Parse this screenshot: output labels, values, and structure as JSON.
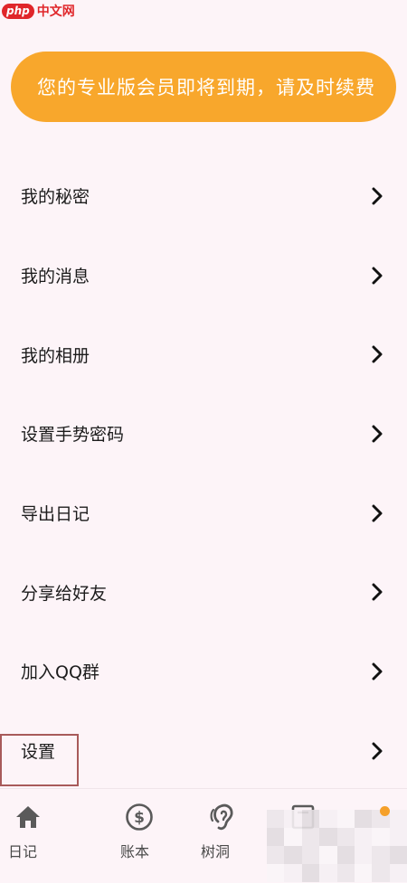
{
  "watermark": {
    "logo_text": "php",
    "site_text": "中文网"
  },
  "banner": {
    "text": "您的专业版会员即将到期，请及时续费",
    "color": "#f8a72c"
  },
  "menu": {
    "items": [
      {
        "label": "我的秘密",
        "icon": "chevron-right-icon"
      },
      {
        "label": "我的消息",
        "icon": "chevron-right-icon"
      },
      {
        "label": "我的相册",
        "icon": "chevron-right-icon"
      },
      {
        "label": "设置手势密码",
        "icon": "chevron-right-icon"
      },
      {
        "label": "导出日记",
        "icon": "chevron-right-icon"
      },
      {
        "label": "分享给好友",
        "icon": "chevron-right-icon"
      },
      {
        "label": "加入QQ群",
        "icon": "chevron-right-icon"
      },
      {
        "label": "设置",
        "icon": "chevron-right-icon",
        "highlighted": true
      }
    ]
  },
  "tabbar": {
    "tabs": [
      {
        "label": "日记",
        "icon": "home-icon"
      },
      {
        "label": "账本",
        "icon": "dollar-circle-icon"
      },
      {
        "label": "树洞",
        "icon": "ear-icon"
      },
      {
        "label": "",
        "icon": "document-icon"
      },
      {
        "label": "",
        "icon": "notification-dot-icon"
      }
    ],
    "accent": "#f5a02a"
  }
}
